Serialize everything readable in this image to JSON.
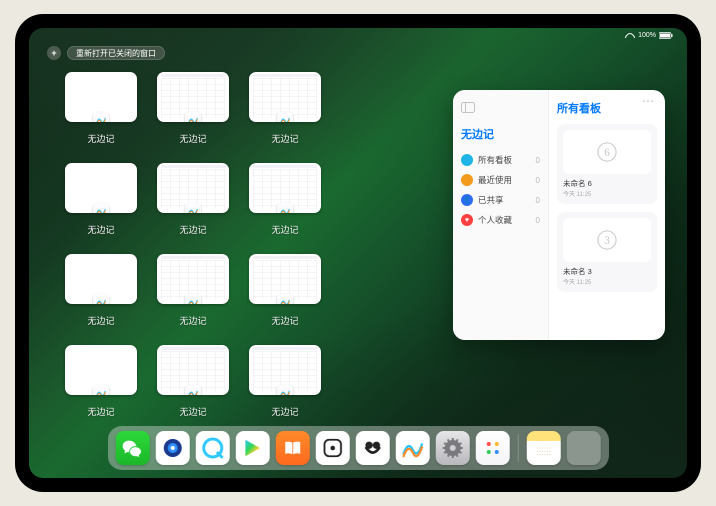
{
  "status": {
    "battery": "100%"
  },
  "topbar": {
    "add": "+",
    "reopen_label": "重新打开已关闭的窗口"
  },
  "app_name": "无边记",
  "windows": [
    {
      "label": "无边记",
      "style": "blank"
    },
    {
      "label": "无边记",
      "style": "grid"
    },
    {
      "label": "无边记",
      "style": "grid"
    },
    {
      "label": "无边记",
      "style": "blank"
    },
    {
      "label": "无边记",
      "style": "grid"
    },
    {
      "label": "无边记",
      "style": "grid"
    },
    {
      "label": "无边记",
      "style": "blank"
    },
    {
      "label": "无边记",
      "style": "grid"
    },
    {
      "label": "无边记",
      "style": "grid"
    },
    {
      "label": "无边记",
      "style": "blank"
    },
    {
      "label": "无边记",
      "style": "grid"
    },
    {
      "label": "无边记",
      "style": "grid"
    }
  ],
  "panel": {
    "left_title": "无边记",
    "right_title": "所有看板",
    "categories": [
      {
        "label": "所有看板",
        "count": "0",
        "color": "#1fb4e6"
      },
      {
        "label": "最近使用",
        "count": "0",
        "color": "#f29b1d"
      },
      {
        "label": "已共享",
        "count": "0",
        "color": "#2f6cf6"
      },
      {
        "label": "个人收藏",
        "count": "0",
        "color": "#ff4040"
      }
    ],
    "boards": [
      {
        "name": "未命名 6",
        "date": "今天 11:25",
        "glyph": "6"
      },
      {
        "name": "未命名 3",
        "date": "今天 11:25",
        "glyph": "3"
      }
    ]
  },
  "dock": [
    {
      "name": "wechat",
      "bg": "linear-gradient(180deg,#2dd83a,#1bb82a)"
    },
    {
      "name": "qqbrowser",
      "bg": "#fff"
    },
    {
      "name": "browser-q",
      "bg": "#fff"
    },
    {
      "name": "play",
      "bg": "#fff"
    },
    {
      "name": "books",
      "bg": "linear-gradient(180deg,#ff8a2a,#ff6a1e)"
    },
    {
      "name": "dice",
      "bg": "#fff"
    },
    {
      "name": "himalaya",
      "bg": "#fff"
    },
    {
      "name": "freeform",
      "bg": "#fff"
    },
    {
      "name": "settings",
      "bg": "linear-gradient(180deg,#e6e6e8,#b9b9bd)"
    },
    {
      "name": "more1",
      "bg": "linear-gradient(180deg,#fff,#f5f5f8)"
    },
    {
      "name": "notes",
      "bg": "linear-gradient(180deg,#ffe27a 30%,#fff 30%)"
    },
    {
      "name": "recents",
      "bg": "multi"
    }
  ]
}
